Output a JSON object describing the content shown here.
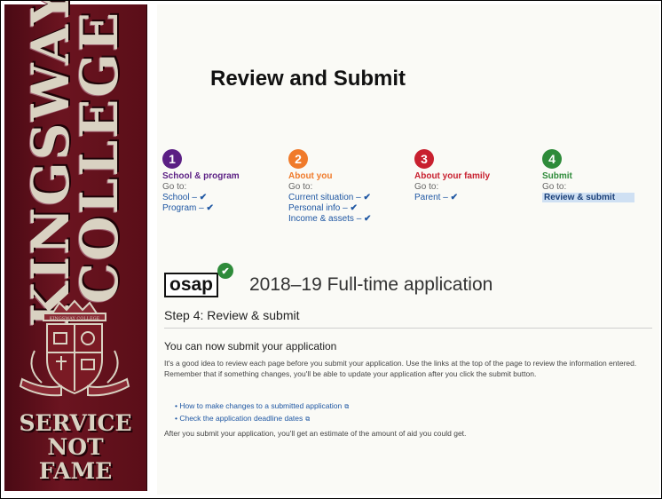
{
  "banner": {
    "college_line1": "KINGSWAY",
    "college_line2": "COLLEGE",
    "crest_text": "KINGSWAY COLLEGE",
    "motto_line1": "SERVICE",
    "motto_line2": "NOT",
    "motto_line3": "FAME"
  },
  "slide": {
    "title": "Review and Submit"
  },
  "steps": [
    {
      "number": "1",
      "name": "School & program",
      "goto": "Go to:",
      "color": "#5b1f84",
      "links": [
        {
          "label": "School –",
          "check": "✔"
        },
        {
          "label": "Program –",
          "check": "✔"
        }
      ]
    },
    {
      "number": "2",
      "name": "About you",
      "goto": "Go to:",
      "color": "#f07a2a",
      "links": [
        {
          "label": "Current situation –",
          "check": "✔"
        },
        {
          "label": "Personal info –",
          "check": "✔"
        },
        {
          "label": "Income & assets –",
          "check": "✔"
        }
      ]
    },
    {
      "number": "3",
      "name": "About your family",
      "goto": "Go to:",
      "color": "#c8202f",
      "links": [
        {
          "label": "Parent –",
          "check": "✔"
        }
      ]
    },
    {
      "number": "4",
      "name": "Submit",
      "goto": "Go to:",
      "color": "#2e8b3a",
      "links": [
        {
          "label": "Review & submit",
          "check": ""
        }
      ]
    }
  ],
  "application": {
    "logo": "osap",
    "logo_badge": "✔",
    "title": "2018–19 Full-time application",
    "step_title": "Step 4: Review & submit",
    "section_heading": "You can now submit your application",
    "paragraph": "It's a good idea to review each page before you submit your application. Use the links at the top of the page to review the information entered. Remember that if something changes, you'll be able to update your application after you click the submit button.",
    "bullets": [
      {
        "label": "How to make changes to a submitted application",
        "icon": "external-link-icon"
      },
      {
        "label": "Check the application deadline dates",
        "icon": "external-link-icon"
      }
    ],
    "footer": "After you submit your application, you'll get an estimate of the amount of aid you could get."
  }
}
